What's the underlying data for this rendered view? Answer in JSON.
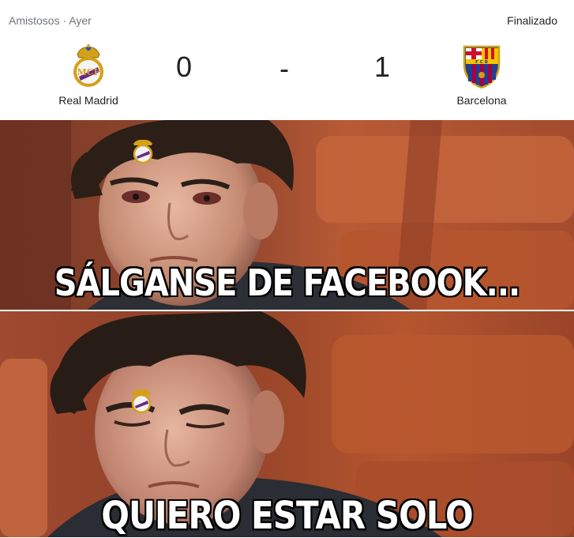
{
  "match": {
    "competition_line": "Amistosos · Ayer",
    "status": "Finalizado",
    "home": {
      "name": "Real Madrid",
      "score": "0",
      "crest": "real-madrid-crest-icon"
    },
    "separator": "-",
    "away": {
      "name": "Barcelona",
      "score": "1",
      "crest": "fc-barcelona-crest-icon"
    }
  },
  "meme": {
    "top_caption": "SÁLGANSE DE FACEBOOK...",
    "bottom_caption": "QUIERO ESTAR SOLO"
  },
  "colors": {
    "meta_gray": "#70757a",
    "text_dark": "#202124",
    "madrid_gold": "#d4a017",
    "barca_blue": "#1f3f8f",
    "barca_red": "#a50044",
    "seat_orange": "#c1552e"
  }
}
